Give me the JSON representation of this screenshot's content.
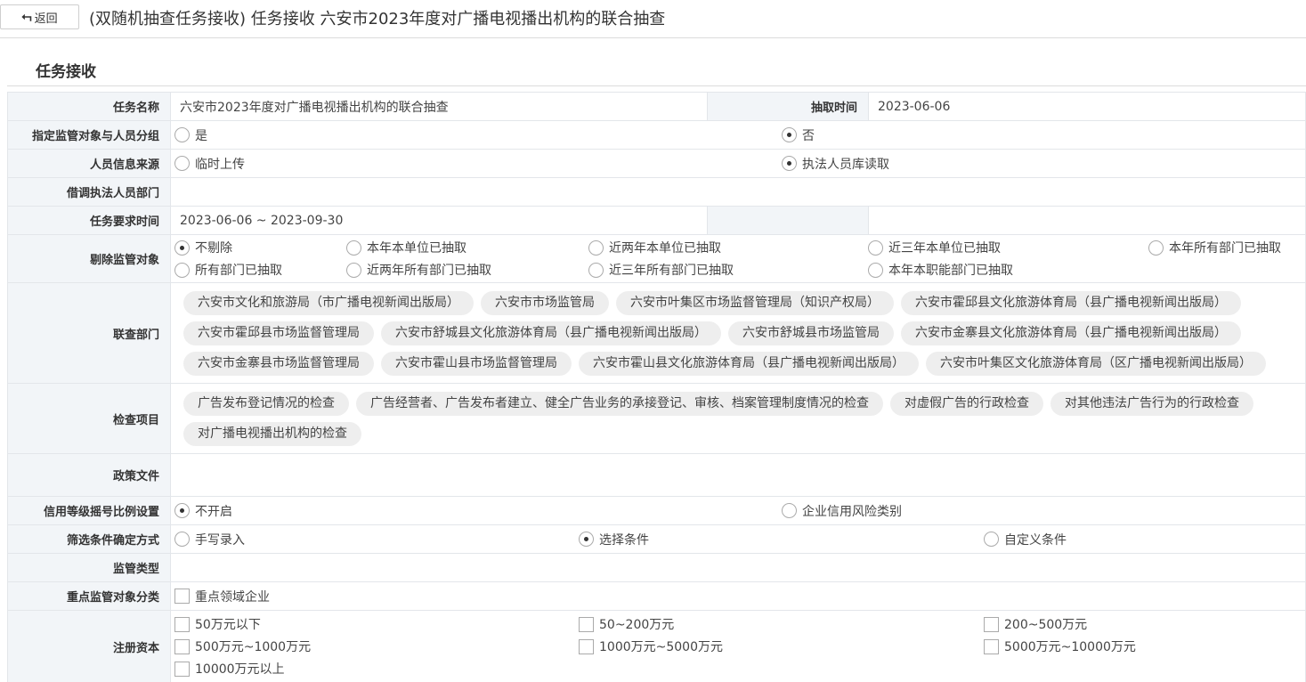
{
  "header": {
    "back_label": "返回",
    "back_icon": "return-arrow-icon",
    "title": "(双随机抽查任务接收) 任务接收 六安市2023年度对广播电视播出机构的联合抽查"
  },
  "section": {
    "title": "任务接收"
  },
  "form": {
    "task_name_label": "任务名称",
    "task_name": "六安市2023年度对广播电视播出机构的联合抽查",
    "draw_time_label": "抽取时间",
    "draw_time": "2023-06-06",
    "assign_label": "指定监管对象与人员分组",
    "assign_yes": "是",
    "assign_no": "否",
    "staff_source_label": "人员信息来源",
    "staff_source_temp": "临时上传",
    "staff_source_db": "执法人员库读取",
    "borrow_dept_label": "借调执法人员部门",
    "period_label": "任务要求时间",
    "period": "2023-06-06 ~ 2023-09-30",
    "exclude_label": "剔除监管对象",
    "exclude_options": [
      "不剔除",
      "本年本单位已抽取",
      "近两年本单位已抽取",
      "近三年本单位已抽取",
      "本年所有部门已抽取",
      "所有部门已抽取",
      "近两年所有部门已抽取",
      "近三年所有部门已抽取",
      "本年本职能部门已抽取"
    ],
    "joint_label": "联查部门",
    "joint_depts": [
      "六安市文化和旅游局（市广播电视新闻出版局）",
      "六安市市场监管局",
      "六安市叶集区市场监督管理局（知识产权局）",
      "六安市霍邱县文化旅游体育局（县广播电视新闻出版局）",
      "六安市霍邱县市场监督管理局",
      "六安市舒城县文化旅游体育局（县广播电视新闻出版局）",
      "六安市舒城县市场监管局",
      "六安市金寨县文化旅游体育局（县广播电视新闻出版局）",
      "六安市金寨县市场监督管理局",
      "六安市霍山县市场监督管理局",
      "六安市霍山县文化旅游体育局（县广播电视新闻出版局）",
      "六安市叶集区文化旅游体育局（区广播电视新闻出版局）"
    ],
    "items_label": "检查项目",
    "check_items": [
      "广告发布登记情况的检查",
      "广告经营者、广告发布者建立、健全广告业务的承接登记、审核、档案管理制度情况的检查",
      "对虚假广告的行政检查",
      "对其他违法广告行为的行政检查",
      "对广播电视播出机构的检查"
    ],
    "policy_label": "政策文件",
    "credit_label": "信用等级摇号比例设置",
    "credit_off": "不开启",
    "credit_risk": "企业信用风险类别",
    "filter_label": "筛选条件确定方式",
    "filter_manual": "手写录入",
    "filter_select": "选择条件",
    "filter_custom": "自定义条件",
    "supervise_type_label": "监管类型",
    "key_class_label": "重点监管对象分类",
    "key_class_option": "重点领域企业",
    "capital_label": "注册资本",
    "capital_options": [
      "50万元以下",
      "50~200万元",
      "200~500万元",
      "500万元~1000万元",
      "1000万元~5000万元",
      "5000万元~10000万元",
      "10000万元以上"
    ]
  }
}
